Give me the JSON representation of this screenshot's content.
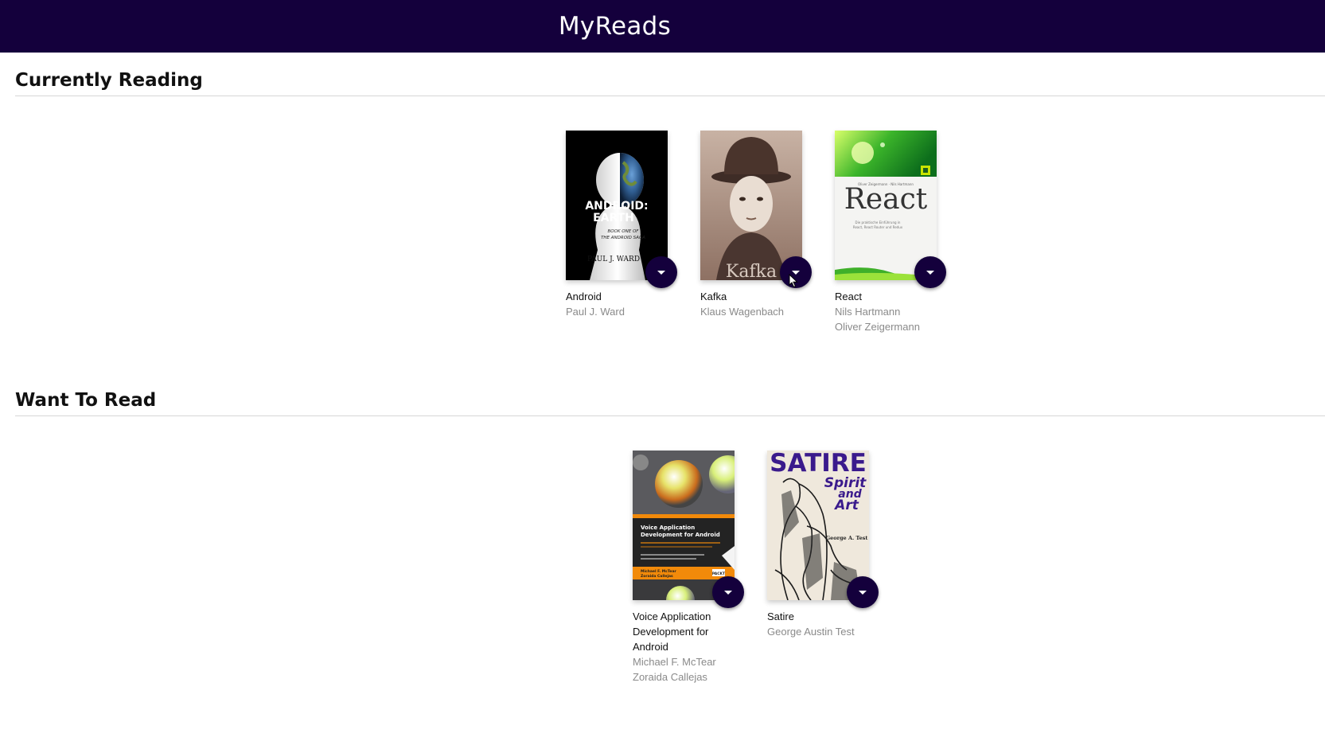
{
  "app": {
    "title": "MyReads"
  },
  "shelves": [
    {
      "title": "Currently Reading",
      "books": [
        {
          "title": "Android",
          "authors": [
            "Paul J. Ward"
          ],
          "cover_text": [
            "ANDROID:",
            "EARTH",
            "BOOK ONE OF",
            "THE ANDROID SAGA",
            "PAUL J. WARD"
          ]
        },
        {
          "title": "Kafka",
          "authors": [
            "Klaus Wagenbach"
          ],
          "cover_text": [
            "Kafka"
          ]
        },
        {
          "title": "React",
          "authors": [
            "Nils Hartmann",
            "Oliver Zeigermann"
          ],
          "cover_text": [
            "Oliver Zeigermann · Nils Hartmann",
            "React",
            "Die praktische Einführung in",
            "React, React Router und Redux"
          ]
        }
      ]
    },
    {
      "title": "Want To Read",
      "books": [
        {
          "title": "Voice Application Development for Android",
          "authors": [
            "Michael F. McTear",
            "Zoraida Callejas"
          ],
          "cover_text": [
            "Voice Application",
            "Development for Android",
            "Michael F. McTear",
            "Zoraida Callejas",
            "PACKT"
          ]
        },
        {
          "title": "Satire",
          "authors": [
            "George Austin Test"
          ],
          "cover_text": [
            "SATIRE",
            "Spirit",
            "and",
            "Art",
            "George A. Test"
          ]
        }
      ]
    }
  ],
  "colors": {
    "header_bg": "#14003c",
    "button_bg": "#14003c",
    "author_text": "#8a8a8a",
    "divider": "#d6d6d6"
  },
  "icons": {
    "shelf_changer": "arrow-drop-down-icon"
  }
}
